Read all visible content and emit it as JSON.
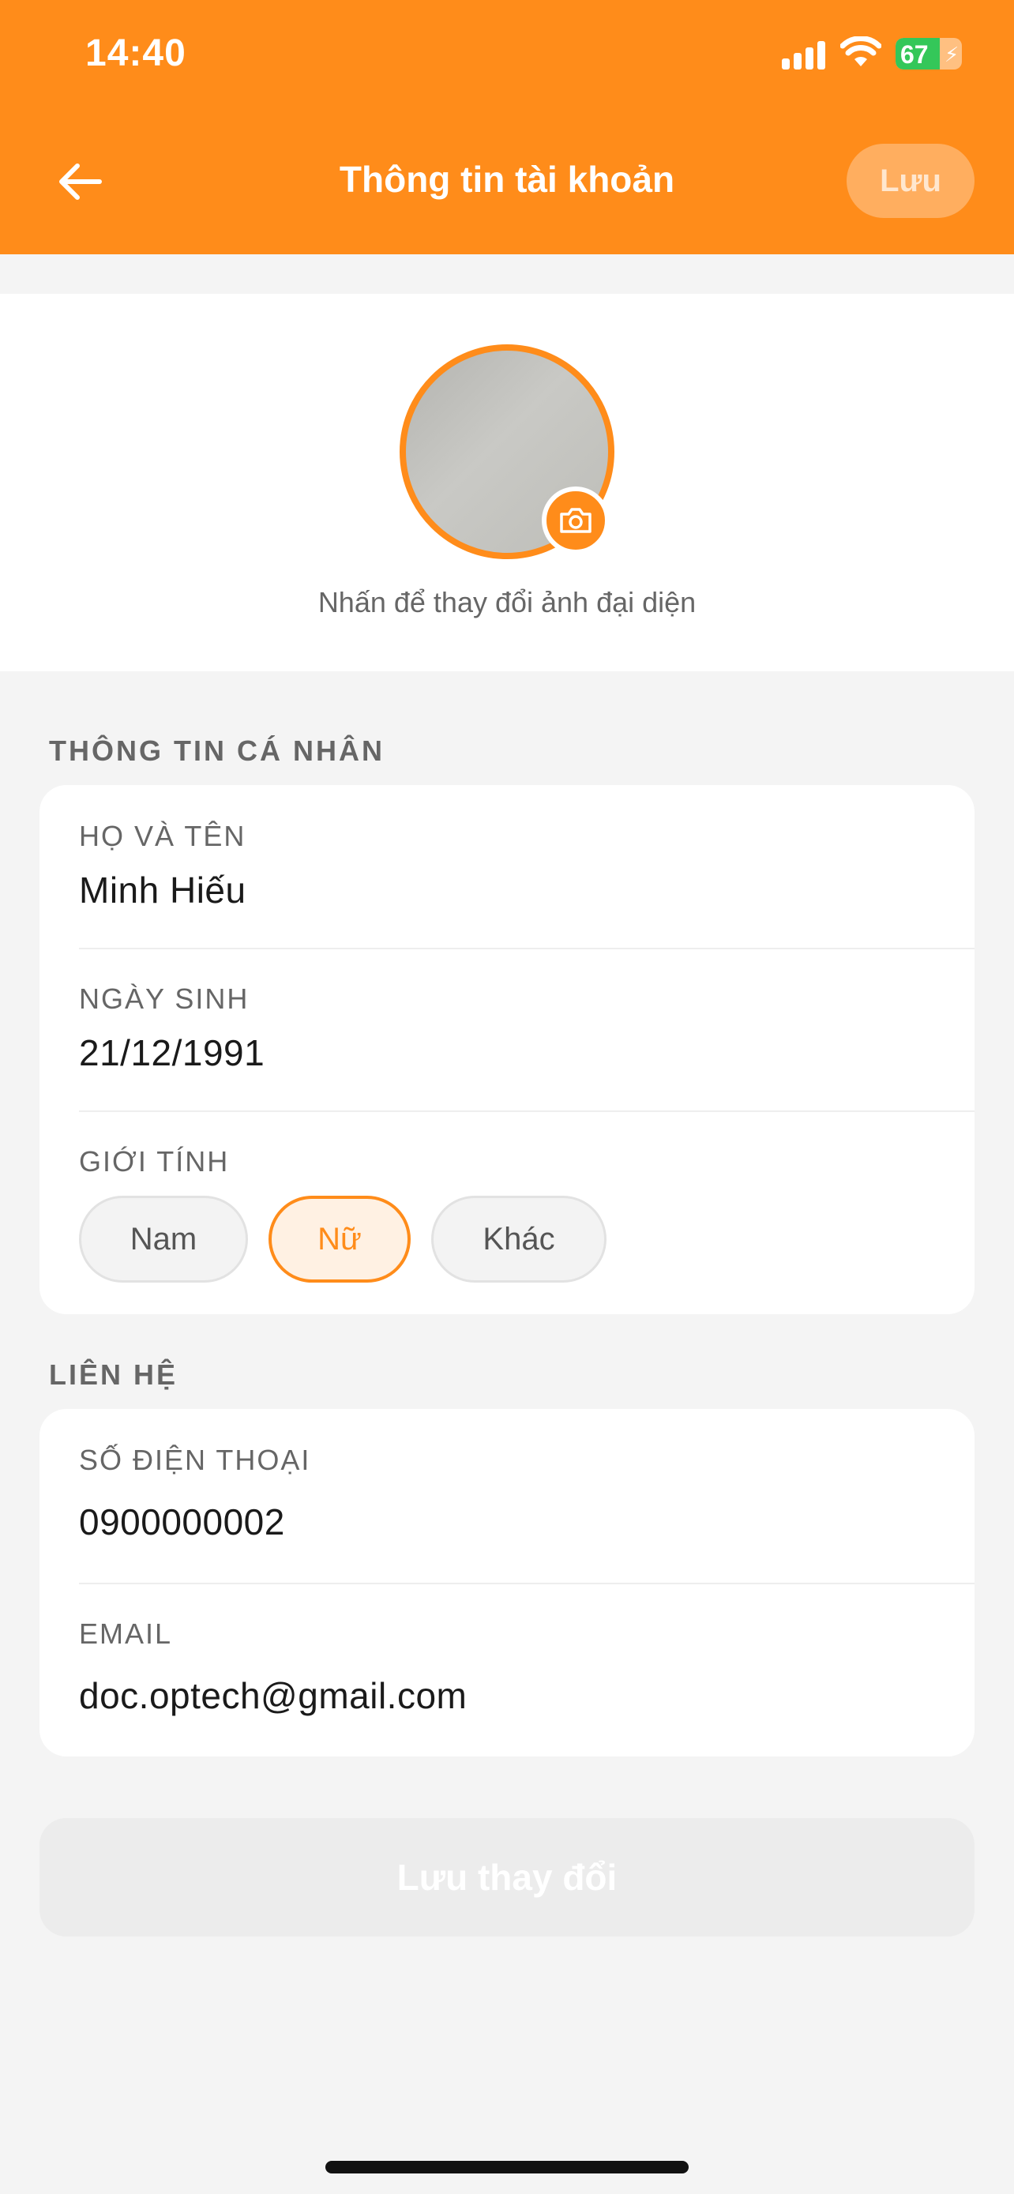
{
  "status_bar": {
    "time": "14:40",
    "battery_percent": "67",
    "battery_level": 0.67,
    "charging": true
  },
  "nav": {
    "title": "Thông tin tài khoản",
    "save_label": "Lưu",
    "back_icon": "arrow-left-icon"
  },
  "avatar": {
    "hint": "Nhấn để thay đổi ảnh đại diện",
    "badge_icon": "camera-icon"
  },
  "personal": {
    "section_title": "THÔNG TIN CÁ NHÂN",
    "full_name": {
      "label": "HỌ VÀ TÊN",
      "value": "Minh Hiếu"
    },
    "birthday": {
      "label": "NGÀY SINH",
      "value": "21/12/1991"
    },
    "gender": {
      "label": "GIỚI TÍNH",
      "options": [
        "Nam",
        "Nữ",
        "Khác"
      ],
      "selected": "Nữ"
    }
  },
  "contact": {
    "section_title": "LIÊN HỆ",
    "phone": {
      "label": "SỐ ĐIỆN THOẠI",
      "value": "0900000002"
    },
    "email": {
      "label": "EMAIL",
      "value": "doc.optech@gmail.com"
    }
  },
  "footer": {
    "save_changes_label": "Lưu thay đổi"
  },
  "colors": {
    "primary": "#ff8c1a",
    "background": "#f4f4f4",
    "card": "#ffffff",
    "label": "#666666",
    "value": "#1a1a1a",
    "selected_chip_bg": "#fff1e3",
    "battery_fill": "#34c759"
  }
}
